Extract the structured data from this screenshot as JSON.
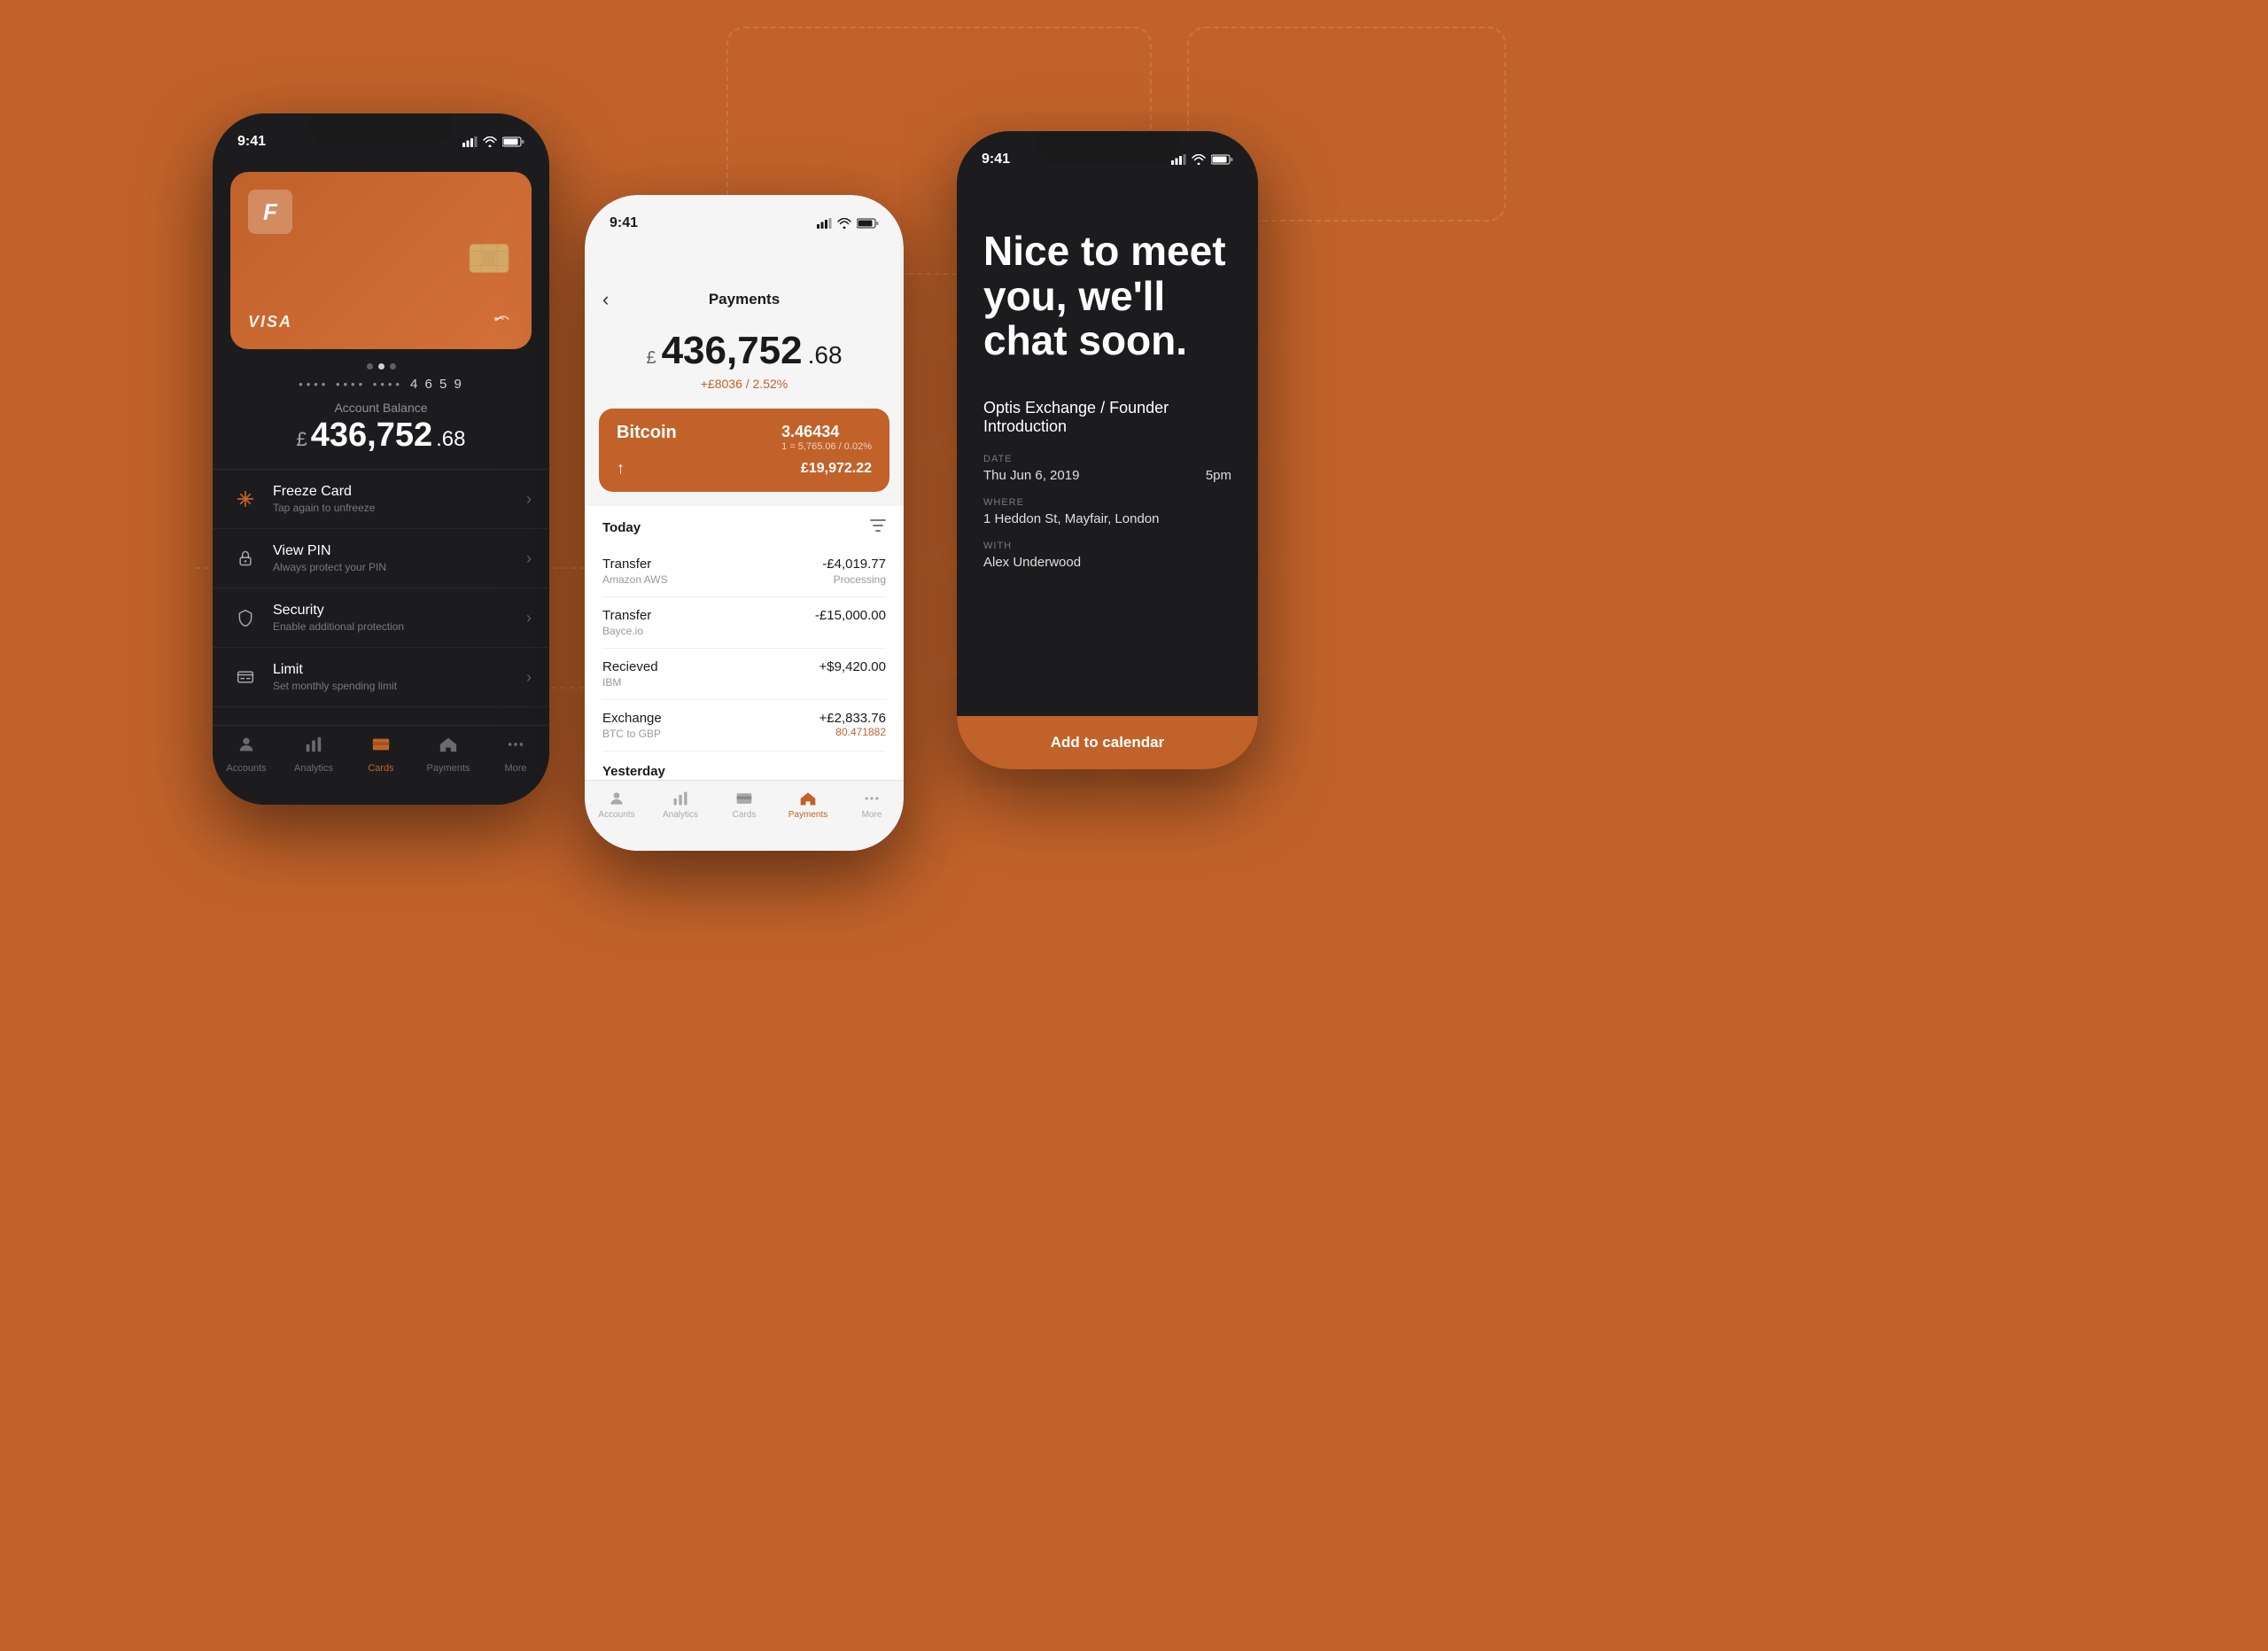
{
  "background": "#C1622A",
  "phone1": {
    "time": "9:41",
    "card": {
      "logo": "F",
      "number_dots": "•••• •••• ••••",
      "number_last": "4 6 5 9",
      "brand": "VISA"
    },
    "dots": [
      "inactive",
      "active",
      "inactive"
    ],
    "balance_label": "Account Balance",
    "balance_currency": "£",
    "balance_main": " 436,752",
    "balance_decimal": ".68",
    "menu_items": [
      {
        "icon": "freeze",
        "title": "Freeze Card",
        "subtitle": "Tap again to unfreeze"
      },
      {
        "icon": "pin",
        "title": "View PIN",
        "subtitle": "Always protect your PIN"
      },
      {
        "icon": "security",
        "title": "Security",
        "subtitle": "Enable additional protection"
      },
      {
        "icon": "limit",
        "title": "Limit",
        "subtitle": "Set monthly spending limit"
      }
    ],
    "nav": [
      {
        "icon": "person",
        "label": "Accounts",
        "active": false
      },
      {
        "icon": "chart",
        "label": "Analytics",
        "active": false
      },
      {
        "icon": "card",
        "label": "Cards",
        "active": true
      },
      {
        "icon": "payments",
        "label": "Payments",
        "active": false
      },
      {
        "icon": "more",
        "label": "More",
        "active": false
      }
    ]
  },
  "phone2": {
    "time": "9:41",
    "header": {
      "back": "‹",
      "title": "Payments"
    },
    "balance_currency": "£",
    "balance_main": " 436,752",
    "balance_decimal": ".68",
    "balance_change": "+£8036 / 2.52%",
    "crypto": {
      "name": "Bitcoin",
      "amount": "3.46434",
      "rate": "1 = 5,765.06 / 0.02%",
      "fiat": "£19,972.22",
      "arrow": "↑"
    },
    "sections": [
      {
        "label": "Today",
        "transactions": [
          {
            "type": "Transfer",
            "from": "Amazon AWS",
            "amount": "-£4,019.77",
            "status": "Processing"
          },
          {
            "type": "Transfer",
            "from": "Bayce.io",
            "amount": "-£15,000.00",
            "status": ""
          },
          {
            "type": "Recieved",
            "from": "IBM",
            "amount": "+$9,420.00",
            "status": ""
          },
          {
            "type": "Exchange",
            "from": "BTC to GBP",
            "amount": "+£2,833.76",
            "status_orange": "80.471882"
          }
        ]
      },
      {
        "label": "Yesterday",
        "transactions": []
      }
    ],
    "nav": [
      {
        "icon": "person",
        "label": "Accounts",
        "active": false
      },
      {
        "icon": "chart",
        "label": "Analytics",
        "active": false
      },
      {
        "icon": "card",
        "label": "Cards",
        "active": false
      },
      {
        "icon": "payments",
        "label": "Payments",
        "active": true
      },
      {
        "icon": "more",
        "label": "More",
        "active": false
      }
    ]
  },
  "phone3": {
    "time": "9:41",
    "greeting": "Nice to meet you, we'll chat soon.",
    "event": "Optis Exchange / Founder Introduction",
    "details": [
      {
        "label": "Date",
        "value": "Thu Jun 6, 2019",
        "value2": "5pm"
      },
      {
        "label": "Where",
        "value": "1 Heddon St, Mayfair, London"
      },
      {
        "label": "With",
        "value": "Alex Underwood"
      }
    ],
    "add_button": "Add to calendar"
  }
}
